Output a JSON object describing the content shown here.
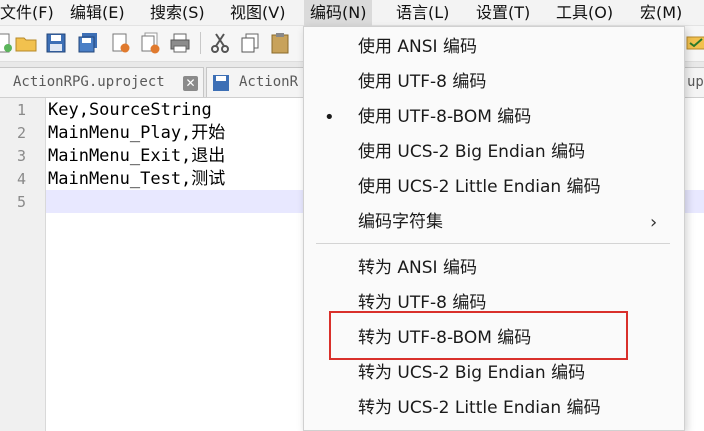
{
  "menubar": {
    "items": [
      {
        "label": "文件(F)"
      },
      {
        "label": "编辑(E)"
      },
      {
        "label": "搜索(S)"
      },
      {
        "label": "视图(V)"
      },
      {
        "label": "编码(N)"
      },
      {
        "label": "语言(L)"
      },
      {
        "label": "设置(T)"
      },
      {
        "label": "工具(O)"
      },
      {
        "label": "宏(M)"
      }
    ],
    "active_index": 4
  },
  "tabs": [
    {
      "label": "ActionRPG.uproject",
      "icon": "save-disk-icon"
    },
    {
      "label": "ActionR",
      "icon": "save-disk-icon"
    },
    {
      "label": "up",
      "icon": "save-disk-icon"
    }
  ],
  "editor": {
    "line_numbers": [
      "1",
      "2",
      "3",
      "4",
      "5"
    ],
    "lines": [
      "Key,SourceString",
      "MainMenu_Play,开始",
      "MainMenu_Exit,退出",
      "MainMenu_Test,测试",
      ""
    ],
    "current_line": 5
  },
  "encoding_menu": {
    "group1": [
      {
        "label": "使用 ANSI 编码",
        "checked": false
      },
      {
        "label": "使用 UTF-8 编码",
        "checked": false
      },
      {
        "label": "使用 UTF-8-BOM 编码",
        "checked": true,
        "bullet": "•"
      },
      {
        "label": "使用 UCS-2 Big Endian 编码",
        "checked": false
      },
      {
        "label": "使用 UCS-2 Little Endian 编码",
        "checked": false
      },
      {
        "label": "编码字符集",
        "submenu": true,
        "arrow": "›"
      }
    ],
    "group2": [
      {
        "label": "转为 ANSI 编码"
      },
      {
        "label": "转为 UTF-8 编码"
      },
      {
        "label": "转为 UTF-8-BOM 编码",
        "highlighted": true
      },
      {
        "label": "转为 UCS-2 Big Endian 编码"
      },
      {
        "label": "转为 UCS-2 Little Endian 编码"
      }
    ]
  },
  "colors": {
    "highlight_box": "#d9302b",
    "current_line": "#e8e8ff",
    "menu_active": "#dadada"
  }
}
